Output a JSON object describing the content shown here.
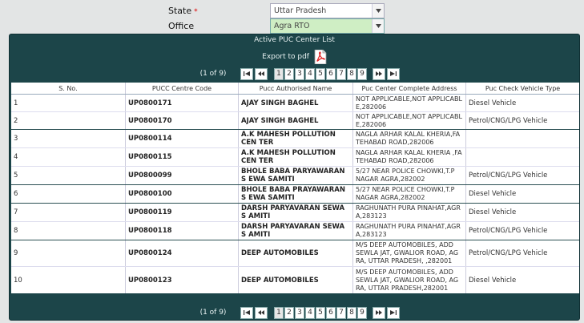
{
  "form": {
    "state_label": "State",
    "required_mark": "*",
    "state_value": "Uttar Pradesh",
    "office_label": "Office",
    "office_value": "Agra RTO"
  },
  "panel": {
    "title": "Active PUC Center List",
    "export_label": "Export to pdf"
  },
  "pager": {
    "info": "(1 of 9)",
    "first": "⏮",
    "prev": "◀◀",
    "next": "▶▶",
    "last": "⏭",
    "pages": [
      "1",
      "2",
      "3",
      "4",
      "5",
      "6",
      "7",
      "8",
      "9"
    ],
    "current": "1"
  },
  "table": {
    "headers": [
      "S. No.",
      "PUCC Centre Code",
      "Pucc Authorised Name",
      "Puc Center Complete Address",
      "Puc Check Vehicle Type"
    ],
    "rows": [
      {
        "sno": "1",
        "code": "UP0800171",
        "name": "AJAY SINGH BAGHEL",
        "address": "NOT APPLICABLE,NOT APPLICABL E,282006",
        "vtype": "Diesel Vehicle"
      },
      {
        "sno": "2",
        "code": "UP0800170",
        "name": "AJAY SINGH BAGHEL",
        "address": "NOT APPLICABLE,NOT APPLICABL E,282006",
        "vtype": "Petrol/CNG/LPG Vehicle"
      },
      {
        "sno": "3",
        "code": "UP0800114",
        "name": "A.K MAHESH POLLUTION CEN TER",
        "address": "NAGLA ARHAR KALAL KHERIA,FA TEHABAD ROAD,282006",
        "vtype": ""
      },
      {
        "sno": "4",
        "code": "UP0800115",
        "name": "A.K MAHESH POLLUTION CEN TER",
        "address": "NAGLA ARHAR KALAL KHERIA ,FA TEHABAD ROAD,282006",
        "vtype": ""
      },
      {
        "sno": "5",
        "code": "UP0800099",
        "name": "BHOLE BABA PARYAWARAN S EWA SAMITI",
        "address": "5/27 NEAR POLICE CHOWKI,T.P NAGAR AGRA,282002",
        "vtype": "Petrol/CNG/LPG Vehicle"
      },
      {
        "sno": "6",
        "code": "UP0800100",
        "name": "BHOLE BABA PRAYAWARAN S EWA SAMITI",
        "address": "5/27 NEAR POLICE CHOWKI,T.P NAGAR AGRA,282002",
        "vtype": "Diesel Vehicle"
      },
      {
        "sno": "7",
        "code": "UP0800119",
        "name": "DARSH PARYAVARAN SEWA S AMITI",
        "address": "RAGHUNATH PURA PINAHAT,AGR A,283123",
        "vtype": "Diesel Vehicle"
      },
      {
        "sno": "8",
        "code": "UP0800118",
        "name": "DARSH PARYAVARAN SEWA S AMITI",
        "address": "RAGHUNATH PURA PINAHAT,AGR A,283123",
        "vtype": "Petrol/CNG/LPG Vehicle"
      },
      {
        "sno": "9",
        "code": "UP0800124",
        "name": "DEEP AUTOMOBILES",
        "address": "M/S DEEP AUTOMOBILES, ADD SEWLA JAT, GWALIOR ROAD, AG RA, UTTAR PRADESH, ,282001",
        "vtype": "Petrol/CNG/LPG Vehicle"
      },
      {
        "sno": "10",
        "code": "UP0800123",
        "name": "DEEP AUTOMOBILES",
        "address": "M/S DEEP AUTOMOBILES, ADD SEWLA JAT, GWALIOR ROAD, AG RA, UTTAR PRADESH,282001",
        "vtype": "Diesel Vehicle"
      }
    ]
  }
}
